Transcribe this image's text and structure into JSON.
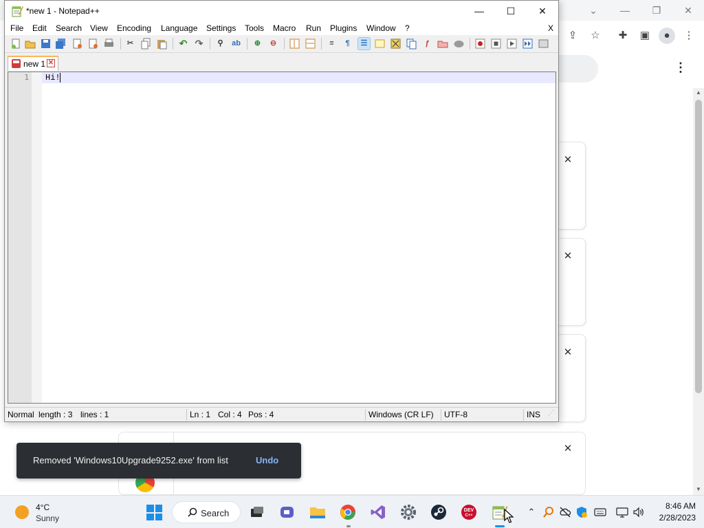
{
  "colors": {
    "accent": "#1c8ee8",
    "toast_bg": "#2b2f33",
    "toast_link": "#8ab4f8",
    "npp_tab_accent": "#ffb35b",
    "line_highlight": "#e8e8ff"
  },
  "browser": {
    "card_close_icon": "close-icon",
    "menu_icon": "kebab-menu-icon"
  },
  "notepad": {
    "title": "*new 1 - Notepad++",
    "menu": [
      "File",
      "Edit",
      "Search",
      "View",
      "Encoding",
      "Language",
      "Settings",
      "Tools",
      "Macro",
      "Run",
      "Plugins",
      "Window",
      "?"
    ],
    "menu_close": "X",
    "tab": {
      "label": "new 1"
    },
    "editor": {
      "line_number": "1",
      "text": "Hi!"
    },
    "status": {
      "mode": "Normal",
      "length": "length : 3",
      "lines": "lines : 1",
      "ln": "Ln : 1",
      "col": "Col : 4",
      "pos": "Pos : 4",
      "eol": "Windows (CR LF)",
      "encoding": "UTF-8",
      "ins": "INS"
    }
  },
  "toast": {
    "message": "Removed 'Windows10Upgrade9252.exe' from list",
    "action": "Undo"
  },
  "taskbar": {
    "weather": {
      "temp": "4°C",
      "condition": "Sunny"
    },
    "search_label": "Search",
    "clock": {
      "time": "8:46 AM",
      "date": "2/28/2023"
    },
    "dev_label": "DEV C++"
  }
}
